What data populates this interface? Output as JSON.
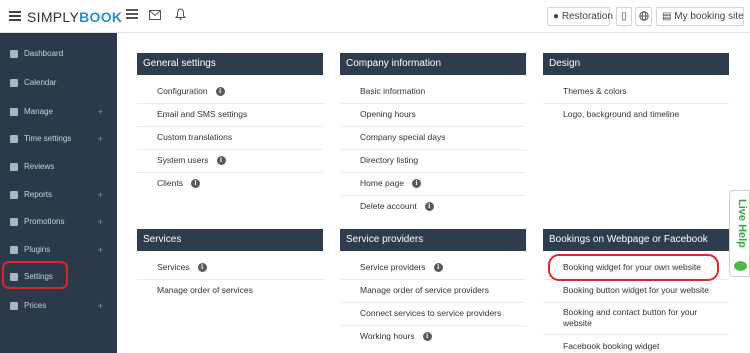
{
  "brand": {
    "prefix": "SIMPLY",
    "suffix": "BOOK"
  },
  "topbar": {
    "restoration_label": "Restoration",
    "booking_site_label": "My booking site"
  },
  "sidebar": {
    "items": [
      {
        "label": "Dashboard",
        "icon": "dashboard-icon",
        "plus": ""
      },
      {
        "label": "Calendar",
        "icon": "calendar-icon",
        "plus": ""
      },
      {
        "label": "Manage",
        "icon": "user-icon",
        "plus": "+"
      },
      {
        "label": "Time settings",
        "icon": "clock-icon",
        "plus": "+"
      },
      {
        "label": "Reviews",
        "icon": "comments-icon",
        "plus": ""
      },
      {
        "label": "Reports",
        "icon": "bar-chart-icon",
        "plus": "+"
      },
      {
        "label": "Promotions",
        "icon": "bullhorn-icon",
        "plus": "+"
      },
      {
        "label": "Plugins",
        "icon": "plug-icon",
        "plus": "+"
      },
      {
        "label": "Settings",
        "icon": "gears-icon",
        "plus": ""
      },
      {
        "label": "Prices",
        "icon": "money-icon",
        "plus": "+"
      }
    ]
  },
  "panels": {
    "general": {
      "title": "General settings",
      "links": [
        "Configuration",
        "Email and SMS settings",
        "Custom translations",
        "System users",
        "Clients"
      ]
    },
    "company": {
      "title": "Company information",
      "links": [
        "Basic information",
        "Opening hours",
        "Company special days",
        "Directory listing",
        "Home page",
        "Delete account"
      ]
    },
    "design": {
      "title": "Design",
      "links": [
        "Themes & colors",
        "Logo, background and timeline"
      ]
    },
    "services": {
      "title": "Services",
      "links": [
        "Services",
        "Manage order of services"
      ]
    },
    "providers": {
      "title": "Service providers",
      "links": [
        "Service providers",
        "Manage order of service providers",
        "Connect services to service providers",
        "Working hours"
      ]
    },
    "bookings": {
      "title": "Bookings on Webpage or Facebook",
      "links": [
        "Booking widget for your own website",
        "Booking button widget for your website",
        "Booking and contact button for your",
        "website",
        "Facebook booking widget"
      ]
    }
  },
  "info_glyph": "i",
  "live_help": "Live Help",
  "colors": {
    "sidebar_bg": "#2b3a4a",
    "panel_header": "#2e3d4d",
    "highlight": "#e0242c",
    "brand_blue": "#2a8fc9",
    "live_help_green": "#3aa545"
  }
}
